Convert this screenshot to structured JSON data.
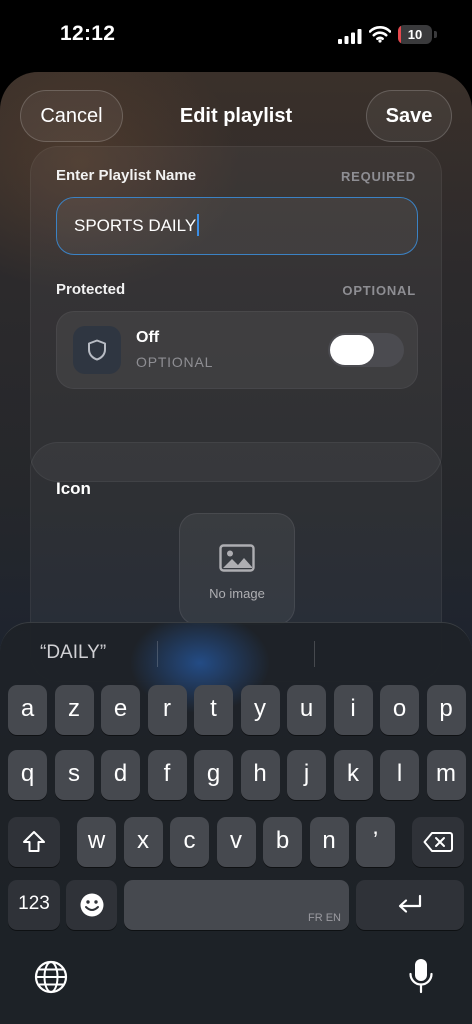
{
  "status_bar": {
    "time": "12:12",
    "battery": "10",
    "battery_fraction": 0.1,
    "battery_color": "#e5484d"
  },
  "header": {
    "cancel_label": "Cancel",
    "title": "Edit playlist",
    "save_label": "Save"
  },
  "playlist_name": {
    "label": "Enter Playlist Name",
    "tag": "REQUIRED",
    "value": "SPORTS DAILY"
  },
  "protected": {
    "label": "Protected",
    "tag": "OPTIONAL",
    "state": "Off",
    "subtitle": "OPTIONAL",
    "toggle_on": false,
    "icon": "shield-icon"
  },
  "icon_section": {
    "label": "Icon",
    "placeholder": "No image",
    "icon": "image-icon"
  },
  "keyboard": {
    "suggestions": [
      "“DAILY”",
      "",
      ""
    ],
    "row1": [
      "a",
      "z",
      "e",
      "r",
      "t",
      "y",
      "u",
      "i",
      "o",
      "p"
    ],
    "row2": [
      "q",
      "s",
      "d",
      "f",
      "g",
      "h",
      "j",
      "k",
      "l",
      "m"
    ],
    "row3": [
      "w",
      "x",
      "c",
      "v",
      "b",
      "n",
      "’"
    ],
    "numbers_label": "123",
    "space_languages": "FR EN",
    "icons": [
      "shift-icon",
      "backspace-icon",
      "emoji-icon",
      "return-icon",
      "globe-icon",
      "microphone-icon"
    ]
  }
}
